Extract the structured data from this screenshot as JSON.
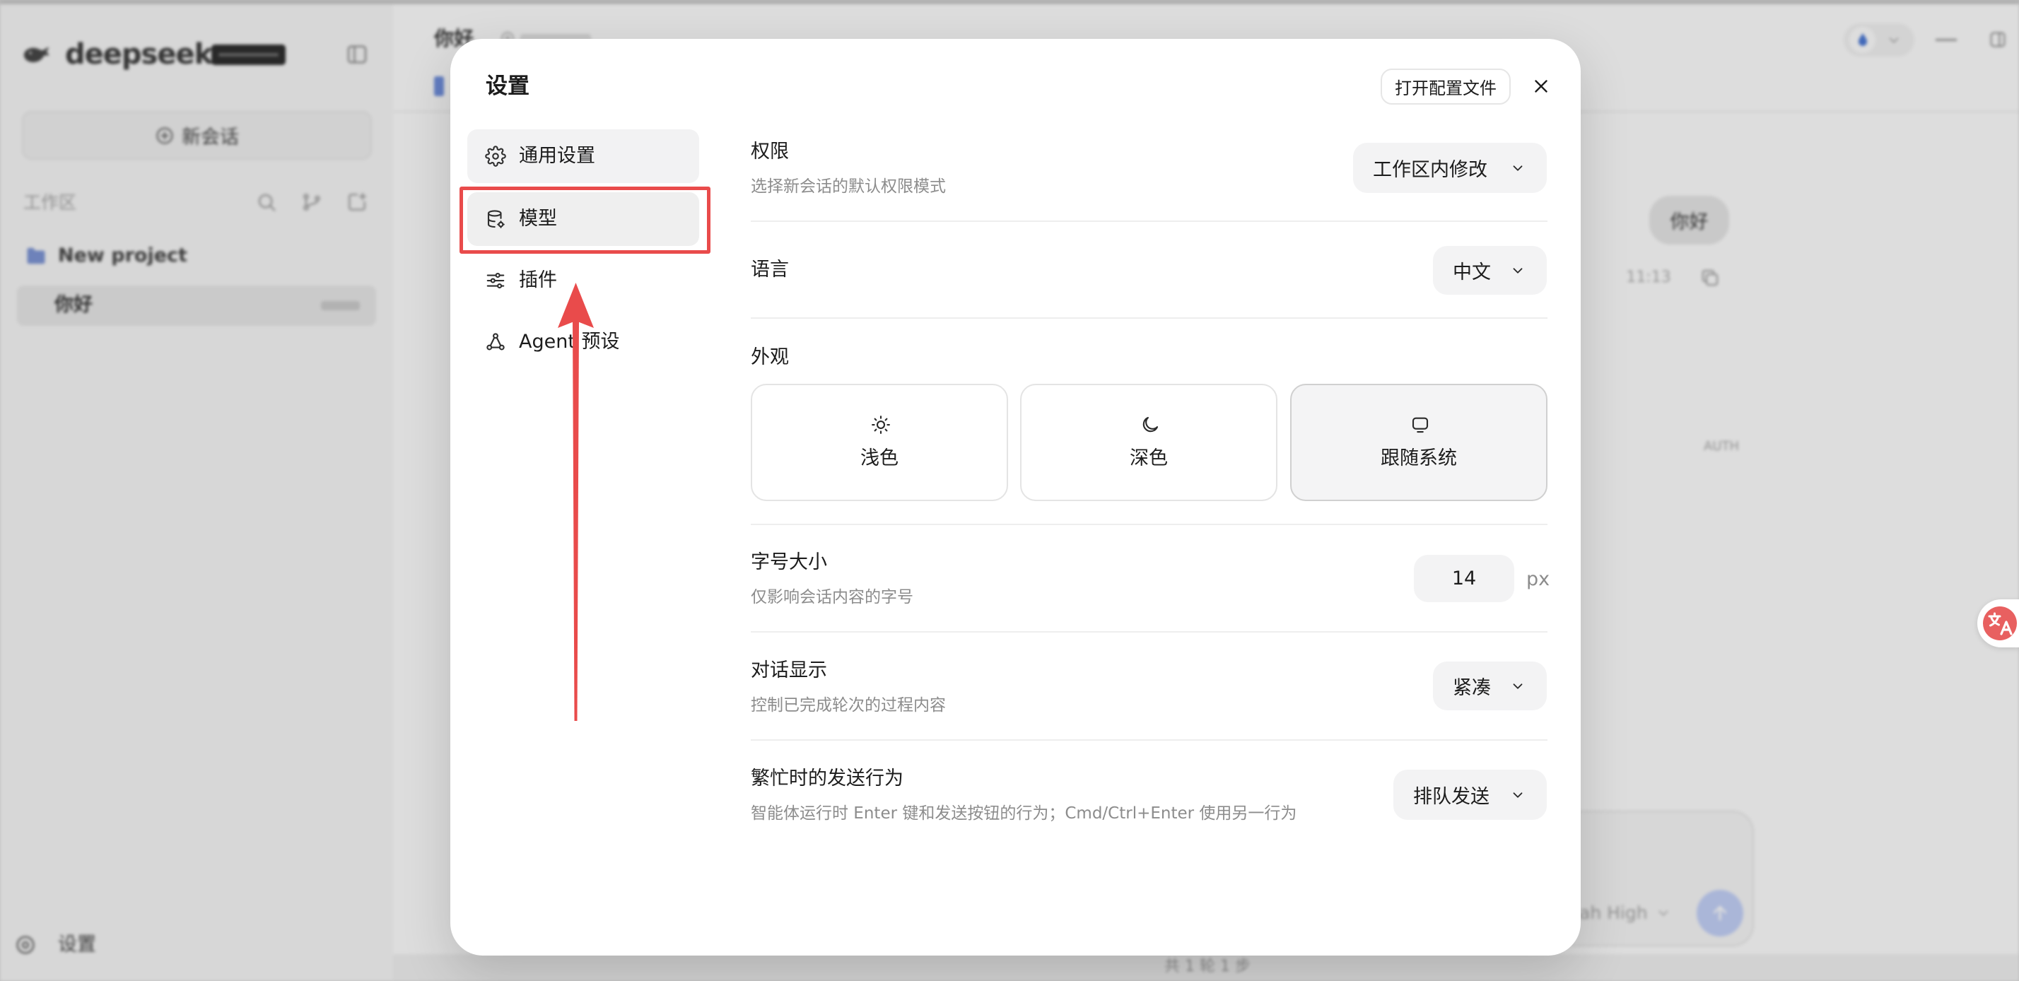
{
  "app": {
    "sidebar": {
      "brand": "deepseek",
      "new_chat_label": "新会话",
      "workspace_label": "工作区",
      "projects": [
        {
          "name": "New project",
          "icon": "folder-icon"
        }
      ],
      "conversations": [
        {
          "title": "你好",
          "selected": true
        }
      ],
      "settings_label": "设置"
    },
    "header": {
      "title": "你好"
    },
    "chat": {
      "messages": [
        {
          "role": "user",
          "text": "你好",
          "time": "11:13"
        }
      ],
      "auth_label": "AUTH",
      "composer": {
        "effort_label": "ah High"
      },
      "status": "共 1 轮 1 步"
    }
  },
  "modal": {
    "title": "设置",
    "open_config_label": "打开配置文件",
    "nav": [
      {
        "label": "通用设置",
        "icon": "gear-icon",
        "active": true
      },
      {
        "label": "模型",
        "icon": "database-icon",
        "highlighted": true
      },
      {
        "label": "插件",
        "icon": "sliders-icon"
      },
      {
        "label": "Agent 预设",
        "icon": "agent-icon"
      }
    ],
    "settings": {
      "permission": {
        "label": "权限",
        "description": "选择新会话的默认权限模式",
        "value": "工作区内修改"
      },
      "language": {
        "label": "语言",
        "value": "中文"
      },
      "appearance": {
        "label": "外观",
        "options": [
          {
            "label": "浅色",
            "icon": "sun-icon",
            "selected": false
          },
          {
            "label": "深色",
            "icon": "moon-icon",
            "selected": false
          },
          {
            "label": "跟随系统",
            "icon": "monitor-icon",
            "selected": true
          }
        ]
      },
      "font_size": {
        "label": "字号大小",
        "description": "仅影响会话内容的字号",
        "value": "14",
        "unit": "px"
      },
      "conversation_display": {
        "label": "对话显示",
        "description": "控制已完成轮次的过程内容",
        "value": "紧凑"
      },
      "busy_send": {
        "label": "繁忙时的发送行为",
        "description": "智能体运行时 Enter 键和发送按钮的行为；Cmd/Ctrl+Enter 使用另一行为",
        "value": "排队发送"
      }
    }
  },
  "colors": {
    "annotation_red": "#e94b4b",
    "send_button": "#c4d2fa",
    "translate_badge": "#e86060",
    "folder_blue": "#7d95d6"
  }
}
